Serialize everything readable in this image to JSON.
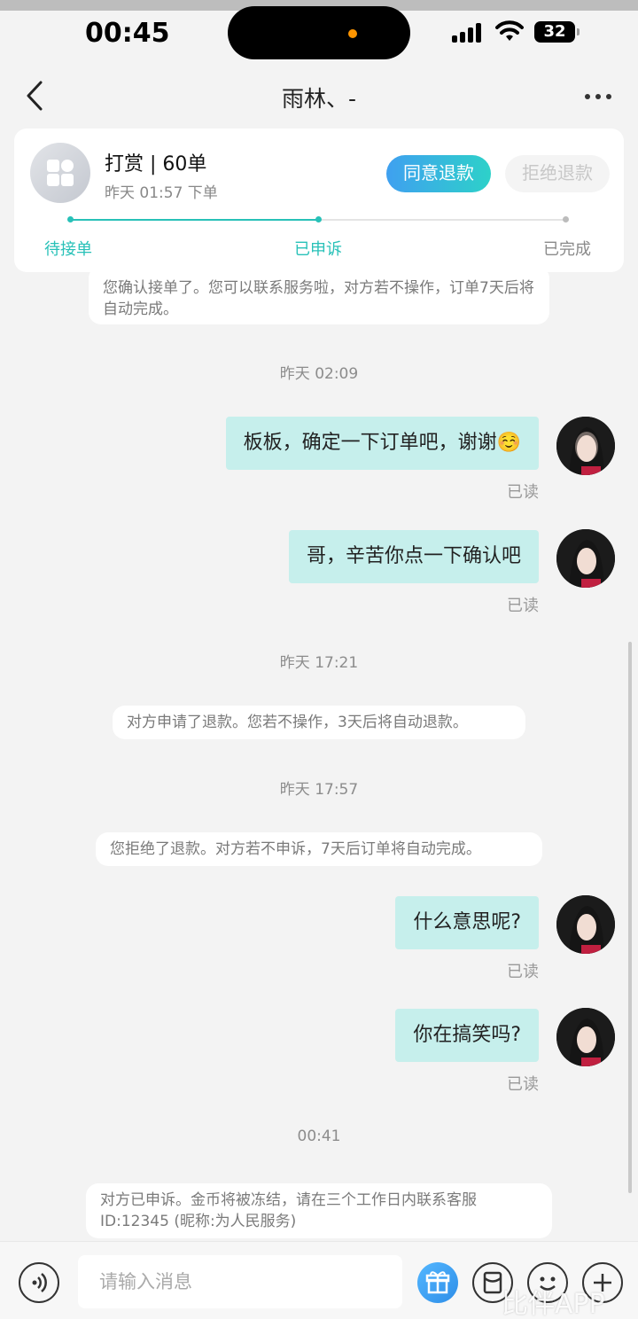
{
  "status_bar": {
    "time": "00:45",
    "battery": "32"
  },
  "nav": {
    "title": "雨林、-"
  },
  "order_card": {
    "title": "打赏 | 60单",
    "time": "昨天 01:57 下单",
    "agree_label": "同意退款",
    "reject_label": "拒绝退款",
    "steps": [
      "待接单",
      "已申诉",
      "已完成"
    ],
    "current_step": 2,
    "progress_fraction": 0.5
  },
  "chat": {
    "sys_confirm": "您确认接单了。您可以联系服务啦，对方若不操作，订单7天后将自动完成。",
    "ts1": "昨天 02:09",
    "msg1": "板板，确定一下订单吧，谢谢☺️",
    "read1": "已读",
    "msg2": "哥，辛苦你点一下确认吧",
    "read2": "已读",
    "ts2": "昨天 17:21",
    "sys_refund": "对方申请了退款。您若不操作，3天后将自动退款。",
    "ts3": "昨天 17:57",
    "sys_reject": "您拒绝了退款。对方若不申诉，7天后订单将自动完成。",
    "msg3": "什么意思呢?",
    "read3": "已读",
    "msg4": "你在搞笑吗?",
    "read4": "已读",
    "ts4": "00:41",
    "sys_appeal": "对方已申诉。金币将被冻结，请在三个工作日内联系客服ID:12345 (昵称:为人民服务)"
  },
  "input_bar": {
    "placeholder": "请输入消息"
  },
  "watermark": "比伴APP",
  "colors": {
    "accent": "#28c1b8",
    "bubble": "#c6efec",
    "agree_start": "#3fa0f0",
    "agree_end": "#2dd1c9"
  }
}
